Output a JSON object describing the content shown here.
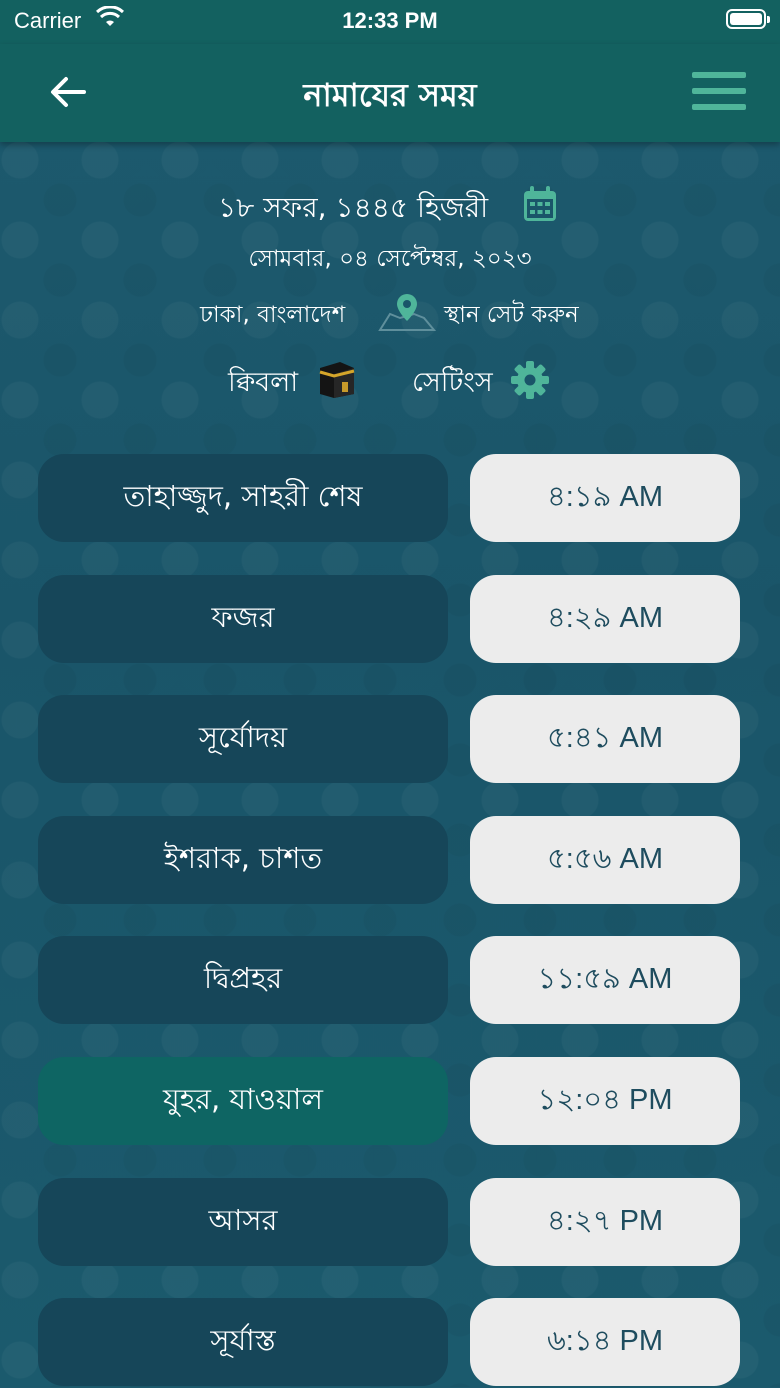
{
  "status_bar": {
    "carrier": "Carrier",
    "time": "12:33 PM"
  },
  "nav": {
    "title": "নামাযের সময়"
  },
  "date": {
    "hijri": "১৮ সফর, ১৪৪৫ হিজরী",
    "gregorian": "সোমবার, ০৪ সেপ্টেম্বর, ২০২৩"
  },
  "location": {
    "name": "ঢাকা, বাংলাদেশ",
    "set_label": "স্থান সেট করুন"
  },
  "actions": {
    "qibla_label": "ক্বিবলা",
    "settings_label": "সেটিংস"
  },
  "colors": {
    "accent": "#4fb59a",
    "header": "#136160",
    "row_bg": "#164659",
    "row_active": "#0e6563"
  },
  "prayers": [
    {
      "name": "তাহাজ্জুদ, সাহরী শেষ",
      "time": "৪:১৯ AM",
      "active": false
    },
    {
      "name": "ফজর",
      "time": "৪:২৯ AM",
      "active": false
    },
    {
      "name": "সূর্যোদয়",
      "time": "৫:৪১ AM",
      "active": false
    },
    {
      "name": "ইশরাক, চাশত",
      "time": "৫:৫৬ AM",
      "active": false
    },
    {
      "name": "দ্বিপ্রহর",
      "time": "১১:৫৯ AM",
      "active": false
    },
    {
      "name": "যুহর, যাওয়াল",
      "time": "১২:০৪ PM",
      "active": true
    },
    {
      "name": "আসর",
      "time": "৪:২৭ PM",
      "active": false
    },
    {
      "name": "সূর্যাস্ত",
      "time": "৬:১৪ PM",
      "active": false
    }
  ]
}
